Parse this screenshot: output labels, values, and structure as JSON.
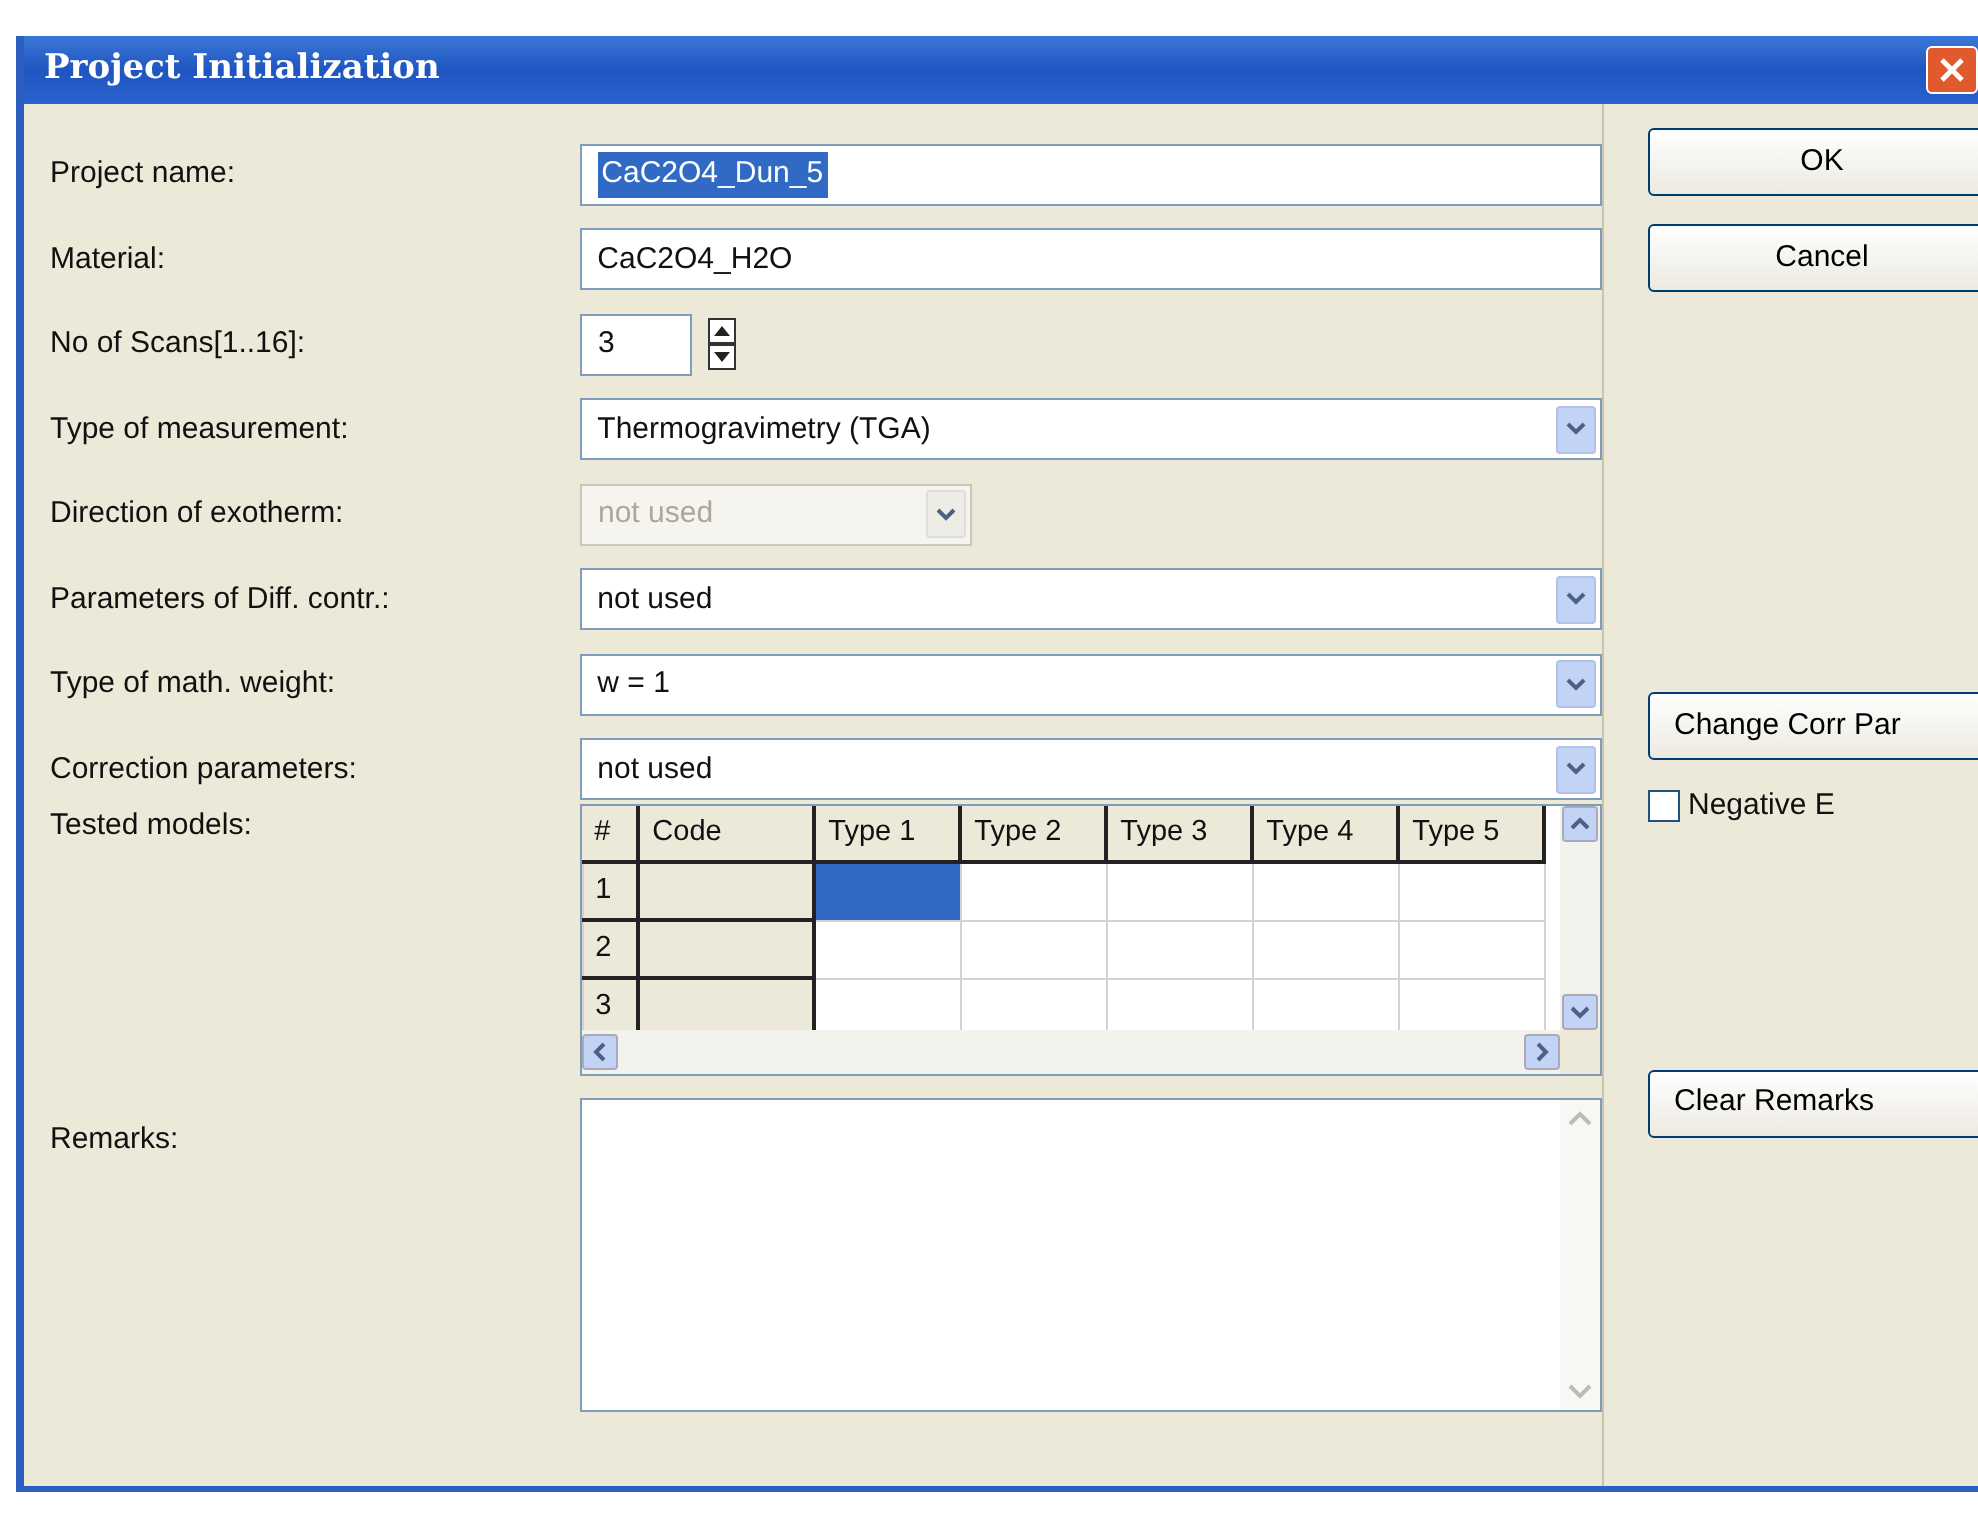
{
  "window": {
    "title": "Project Initialization"
  },
  "fields": [
    {
      "label": "Project name:",
      "kind": "text",
      "value": "CaC2O4_Dun_5",
      "selected": true,
      "disabled": false
    },
    {
      "label": "Material:",
      "kind": "text",
      "value": "CaC2O4_H2O",
      "selected": false,
      "disabled": false
    },
    {
      "label": "No of Scans[1..16]:",
      "kind": "spin",
      "value": "3",
      "selected": false,
      "disabled": false
    },
    {
      "label": "Type of measurement:",
      "kind": "combo",
      "value": "Thermogravimetry (TGA)",
      "selected": false,
      "disabled": false
    },
    {
      "label": "Direction of exotherm:",
      "kind": "combo",
      "value": "not used",
      "selected": false,
      "disabled": true
    },
    {
      "label": "Parameters of Diff. contr.:",
      "kind": "combo",
      "value": "not used",
      "selected": false,
      "disabled": false
    },
    {
      "label": "Type of math. weight:",
      "kind": "combo",
      "value": "w = 1",
      "selected": false,
      "disabled": false
    },
    {
      "label": "Correction parameters:",
      "kind": "combo",
      "value": "not used",
      "selected": false,
      "disabled": false
    }
  ],
  "tested_models": {
    "label": "Tested models:",
    "columns": [
      "#",
      "Code",
      "Type 1",
      "Type 2",
      "Type 3",
      "Type 4",
      "Type 5"
    ],
    "rows": [
      {
        "number": "1",
        "cells": [
          {
            "selected": true
          },
          {
            "selected": false
          },
          {
            "selected": false
          },
          {
            "selected": false
          },
          {
            "selected": false
          }
        ]
      },
      {
        "number": "2",
        "cells": [
          {
            "selected": false
          },
          {
            "selected": false
          },
          {
            "selected": false
          },
          {
            "selected": false
          },
          {
            "selected": false
          }
        ]
      },
      {
        "number": "3",
        "cells": [
          {
            "selected": false
          },
          {
            "selected": false
          },
          {
            "selected": false
          },
          {
            "selected": false
          },
          {
            "selected": false
          }
        ]
      }
    ]
  },
  "remarks": {
    "label": "Remarks:"
  },
  "buttons": {
    "ok": "OK",
    "cancel": "Cancel",
    "change_corr": "Change Corr Par",
    "clear_remarks": "Clear Remarks"
  },
  "negative_e": {
    "label": "Negative E",
    "checked": false
  }
}
